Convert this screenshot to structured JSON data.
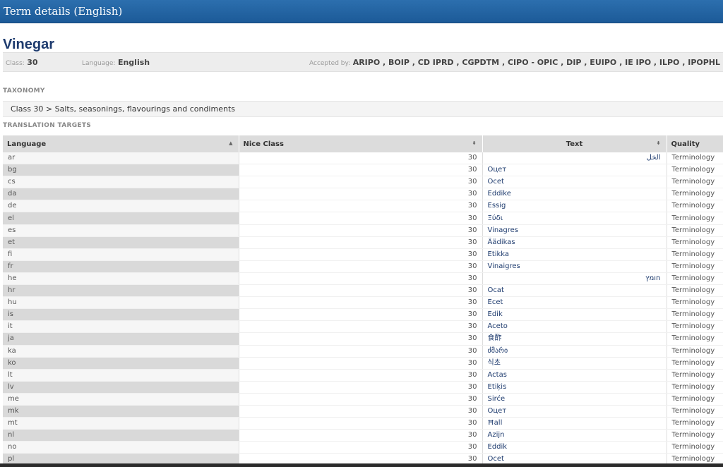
{
  "header": {
    "title": "Term details (English)"
  },
  "term": {
    "title": "Vinegar",
    "class_label": "Class:",
    "class_value": "30",
    "language_label": "Language:",
    "language_value": "English",
    "accepted_label": "Accepted by:",
    "accepted_value": "ARIPO , BOIP , CD IPRD , CGPDTM , CIPO - OPIC , DIP , EUIPO , IE IPO , ILPO , IPOPHL , IPPD ,"
  },
  "taxonomy": {
    "heading": "TAXONOMY",
    "path": "Class 30 > Salts, seasonings, flavourings and condiments"
  },
  "translations": {
    "heading": "TRANSLATION TARGETS",
    "columns": [
      "Language",
      "Nice Class",
      "Text",
      "Quality"
    ],
    "rows": [
      {
        "lang": "ar",
        "nice": "30",
        "text": "الخل",
        "quality": "Terminology",
        "rtl": true
      },
      {
        "lang": "bg",
        "nice": "30",
        "text": "Оцет",
        "quality": "Terminology"
      },
      {
        "lang": "cs",
        "nice": "30",
        "text": "Ocet",
        "quality": "Terminology"
      },
      {
        "lang": "da",
        "nice": "30",
        "text": "Eddike",
        "quality": "Terminology"
      },
      {
        "lang": "de",
        "nice": "30",
        "text": "Essig",
        "quality": "Terminology"
      },
      {
        "lang": "el",
        "nice": "30",
        "text": "Ξύδι",
        "quality": "Terminology"
      },
      {
        "lang": "es",
        "nice": "30",
        "text": "Vinagres",
        "quality": "Terminology"
      },
      {
        "lang": "et",
        "nice": "30",
        "text": "Äädikas",
        "quality": "Terminology"
      },
      {
        "lang": "fi",
        "nice": "30",
        "text": "Etikka",
        "quality": "Terminology"
      },
      {
        "lang": "fr",
        "nice": "30",
        "text": "Vinaigres",
        "quality": "Terminology"
      },
      {
        "lang": "he",
        "nice": "30",
        "text": "חומץ",
        "quality": "Terminology",
        "rtl": true
      },
      {
        "lang": "hr",
        "nice": "30",
        "text": "Ocat",
        "quality": "Terminology"
      },
      {
        "lang": "hu",
        "nice": "30",
        "text": "Ecet",
        "quality": "Terminology"
      },
      {
        "lang": "is",
        "nice": "30",
        "text": "Edik",
        "quality": "Terminology"
      },
      {
        "lang": "it",
        "nice": "30",
        "text": "Aceto",
        "quality": "Terminology"
      },
      {
        "lang": "ja",
        "nice": "30",
        "text": "食酢",
        "quality": "Terminology"
      },
      {
        "lang": "ka",
        "nice": "30",
        "text": "ძმარი",
        "quality": "Terminology"
      },
      {
        "lang": "ko",
        "nice": "30",
        "text": "식초",
        "quality": "Terminology"
      },
      {
        "lang": "lt",
        "nice": "30",
        "text": "Actas",
        "quality": "Terminology"
      },
      {
        "lang": "lv",
        "nice": "30",
        "text": "Etiķis",
        "quality": "Terminology"
      },
      {
        "lang": "me",
        "nice": "30",
        "text": "Sirće",
        "quality": "Terminology"
      },
      {
        "lang": "mk",
        "nice": "30",
        "text": "Оцет",
        "quality": "Terminology"
      },
      {
        "lang": "mt",
        "nice": "30",
        "text": "Ħall",
        "quality": "Terminology"
      },
      {
        "lang": "nl",
        "nice": "30",
        "text": "Azijn",
        "quality": "Terminology"
      },
      {
        "lang": "no",
        "nice": "30",
        "text": "Eddik",
        "quality": "Terminology"
      },
      {
        "lang": "pl",
        "nice": "30",
        "text": "Ocet",
        "quality": "Terminology"
      }
    ]
  }
}
